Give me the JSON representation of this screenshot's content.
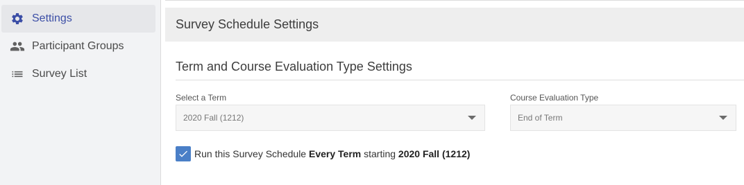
{
  "sidebar": {
    "items": [
      {
        "label": "Settings",
        "icon": "gear-icon",
        "active": true
      },
      {
        "label": "Participant Groups",
        "icon": "people-icon",
        "active": false
      },
      {
        "label": "Survey List",
        "icon": "list-icon",
        "active": false
      }
    ]
  },
  "panel": {
    "title": "Survey Schedule Settings",
    "section_title": "Term and Course Evaluation Type Settings",
    "term_select": {
      "label": "Select a Term",
      "value": "2020 Fall (1212)"
    },
    "eval_select": {
      "label": "Course Evaluation Type",
      "value": "End of Term"
    },
    "checkbox": {
      "checked": true,
      "text_prefix": "Run this Survey Schedule ",
      "text_bold_1": "Every Term",
      "text_middle": " starting ",
      "text_bold_2": "2020 Fall (1212)"
    }
  },
  "colors": {
    "accent": "#3b4ea6",
    "checkbox": "#4a7fc7",
    "sidebar_bg": "#f2f3f5",
    "header_bg": "#eeeeee"
  }
}
